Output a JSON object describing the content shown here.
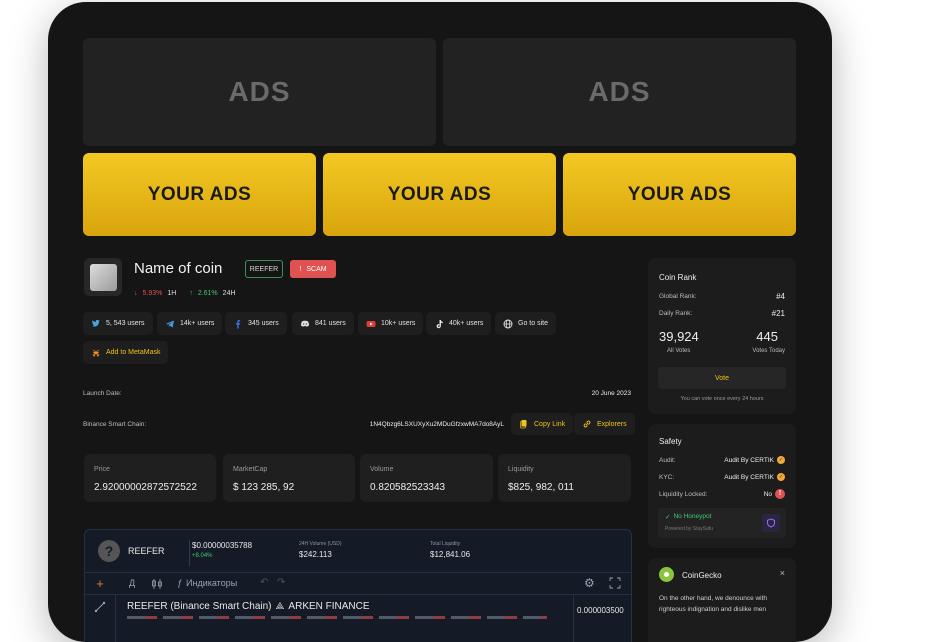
{
  "ads": {
    "top_left": "ADS",
    "top_right": "ADS",
    "yellow": [
      "YOUR ADS",
      "YOUR ADS",
      "YOUR ADS"
    ]
  },
  "coin": {
    "name": "Name of coin",
    "symbol_badge": "REEFER",
    "scam_badge": "SCAM",
    "change_1h": "5.93%",
    "label_1h": "1H",
    "change_24h": "2.61%",
    "label_24h": "24H"
  },
  "socials": [
    {
      "icon": "twitter-icon",
      "label": "5, 543 users"
    },
    {
      "icon": "telegram-icon",
      "label": "14k+ users"
    },
    {
      "icon": "facebook-icon",
      "label": "345 users"
    },
    {
      "icon": "discord-icon",
      "label": "841 users"
    },
    {
      "icon": "youtube-icon",
      "label": "10k+ users"
    },
    {
      "icon": "tiktok-icon",
      "label": "40k+ users"
    },
    {
      "icon": "globe-icon",
      "label": "Go to site"
    }
  ],
  "metamask": "Add to MetaMask",
  "launch": {
    "label": "Launch Date:",
    "value": "20 June 2023"
  },
  "contract": {
    "chain_label": "Binance Smart Chain:",
    "address": "1N4Qbzg6LSXUXyXu2MDuGfzxwMA7do8AyL",
    "copy": "Copy Link",
    "explorers": "Explorers"
  },
  "stats": [
    {
      "label": "Price",
      "value": "2.92000002872572522"
    },
    {
      "label": "MarketCap",
      "value": "$ 123 285, 92"
    },
    {
      "label": "Volume",
      "value": "0.820582523343"
    },
    {
      "label": "Liquidity",
      "value": "$825, 982, 011"
    }
  ],
  "chart_widget": {
    "symbol": "REEFER",
    "price": "$0.00000035788",
    "price_change": "+8.04%",
    "volume_label": "24H Volume (USD)",
    "volume": "$242.113",
    "liq_label": "Total Liquidity",
    "liq": "$12,841.06",
    "toolbar_d": "Д",
    "indicators": "Индикаторы",
    "pair_title": "REEFER (Binance Smart Chain)",
    "pair_dex": "ARKEN FINANCE",
    "last_price": "0.000003500"
  },
  "rank": {
    "title": "Coin Rank",
    "global_label": "Global Rank:",
    "global_value": "#4",
    "daily_label": "Daily Rank:",
    "daily_value": "#21",
    "all_votes": "39,924",
    "all_votes_label": "All Votes",
    "votes_today": "445",
    "votes_today_label": "Votes Today",
    "vote_button": "Vote",
    "vote_note": "You can vote once every 24 hours"
  },
  "safety": {
    "title": "Safety",
    "audit_label": "Audit:",
    "audit_value": "Audit By CERTIK",
    "kyc_label": "KYC:",
    "kyc_value": "Audit By CERTIK",
    "locked_label": "Liquidity Locked:",
    "locked_value": "No",
    "honeypot": "No Honeypot",
    "powered": "Powered by StaySafu"
  },
  "coingecko": {
    "title": "CoinGecko",
    "text": "On the other hand, we denounce with righteous indignation and dislike men"
  },
  "colors": {
    "accent_yellow": "#f0c419",
    "down_red": "#e05252",
    "up_green": "#3dcc74"
  }
}
